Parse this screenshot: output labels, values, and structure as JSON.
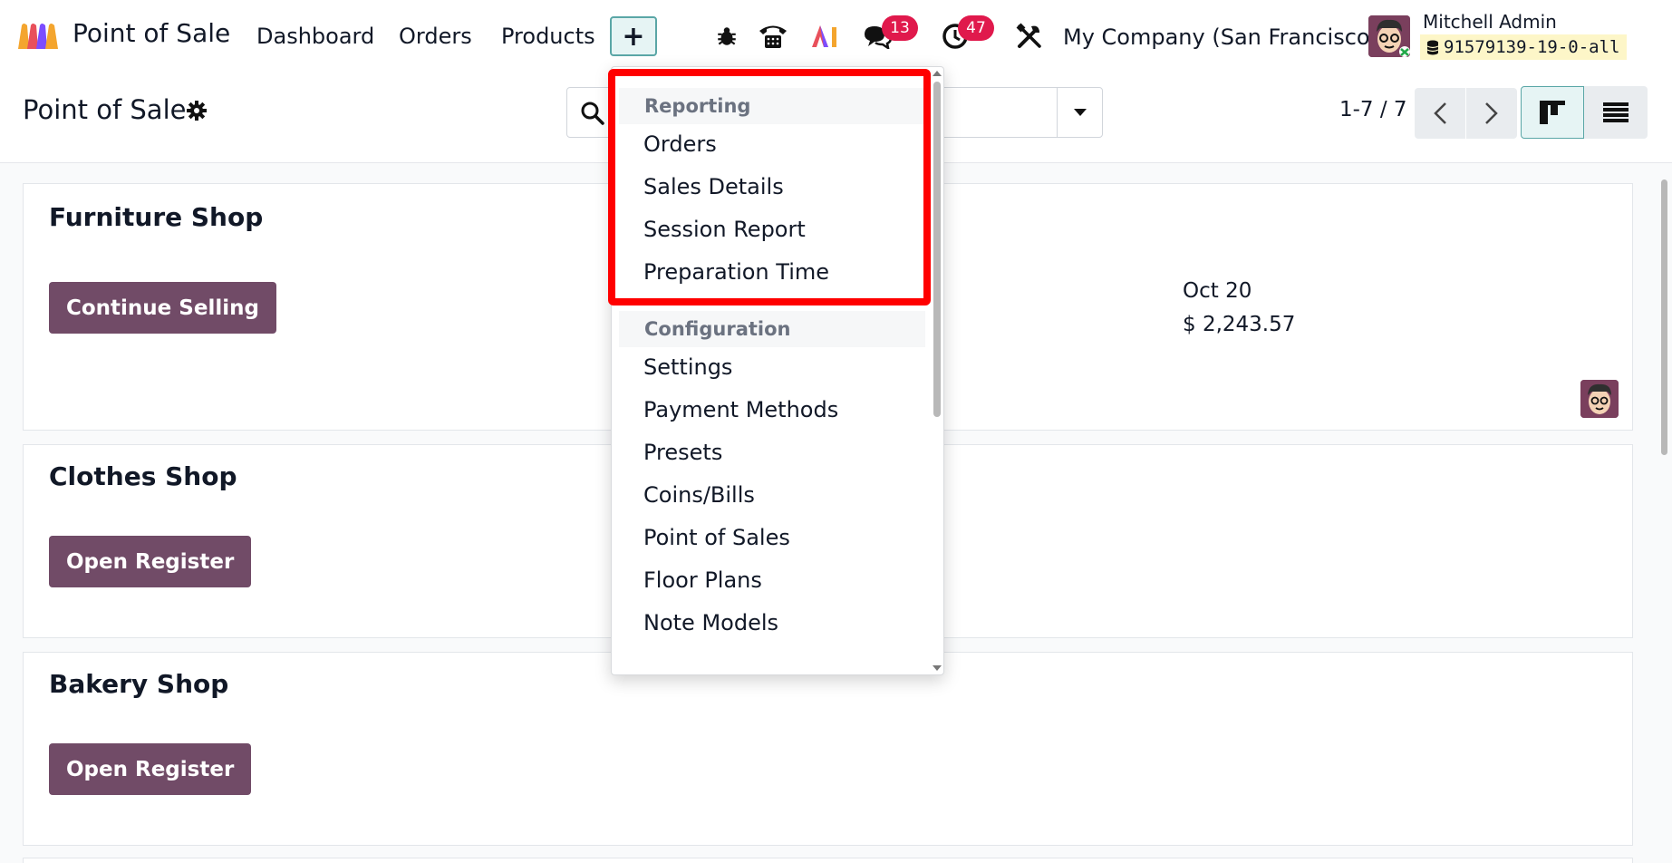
{
  "navbar": {
    "app_name": "Point of Sale",
    "menu": [
      "Dashboard",
      "Orders",
      "Products"
    ],
    "plus_label": "+",
    "chat_badge": "13",
    "activity_badge": "47",
    "company": "My Company (San Francisco)",
    "user_name": "Mitchell Admin",
    "db_name": "91579139-19-0-all"
  },
  "control_panel": {
    "title": "Point of Sale",
    "search_placeholder": "",
    "pager": "1-7 / 7"
  },
  "cards": [
    {
      "title": "Furniture Shop",
      "button": "Continue Selling",
      "date": "Oct 20",
      "amount": "$ 2,243.57"
    },
    {
      "title": "Clothes Shop",
      "button": "Open Register"
    },
    {
      "title": "Bakery Shop",
      "button": "Open Register"
    }
  ],
  "dropdown": {
    "reporting_header": "Reporting",
    "reporting_items": [
      "Orders",
      "Sales Details",
      "Session Report",
      "Preparation Time"
    ],
    "configuration_header": "Configuration",
    "configuration_items": [
      "Settings",
      "Payment Methods",
      "Presets",
      "Coins/Bills",
      "Point of Sales",
      "Floor Plans",
      "Note Models"
    ]
  },
  "colors": {
    "brand": "#714b67",
    "highlight": "#ff0000",
    "badge": "#e0194c"
  }
}
